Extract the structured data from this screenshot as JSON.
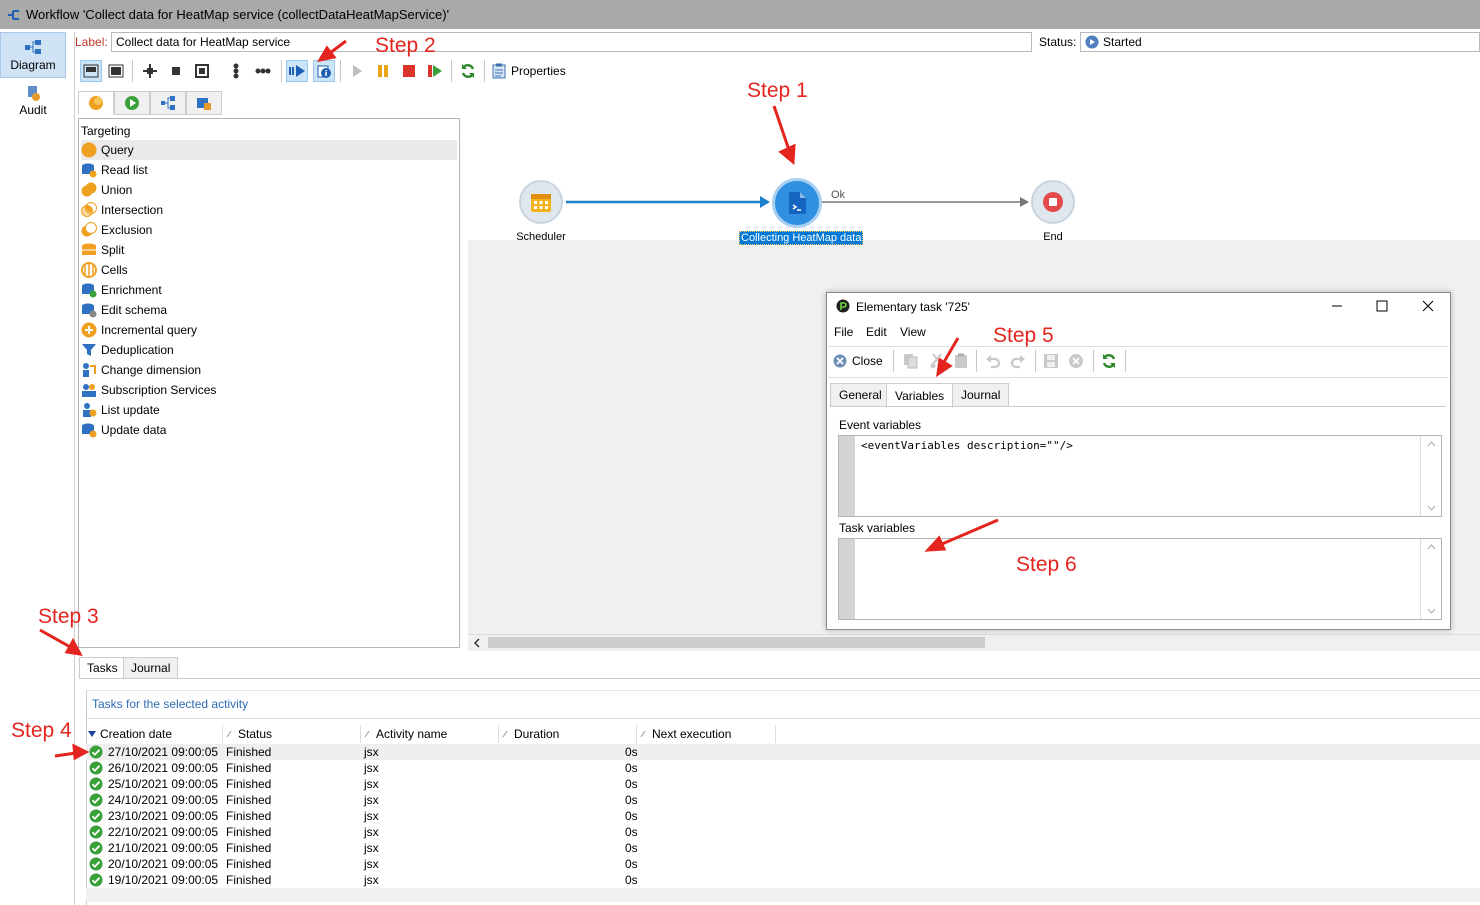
{
  "window": {
    "title": "Workflow 'Collect data for HeatMap service (collectDataHeatMapService)'"
  },
  "nav": [
    {
      "label": "Diagram",
      "icon": "diagram-icon"
    },
    {
      "label": "Audit",
      "icon": "audit-icon"
    }
  ],
  "header": {
    "label_caption": "Label:",
    "label_value": "Collect data for HeatMap service",
    "status_caption": "Status:",
    "status_value": "Started"
  },
  "toolbar": {
    "properties_label": "Properties"
  },
  "palette": {
    "section": "Targeting",
    "items": [
      "Query",
      "Read list",
      "Union",
      "Intersection",
      "Exclusion",
      "Split",
      "Cells",
      "Enrichment",
      "Edit schema",
      "Incremental query",
      "Deduplication",
      "Change dimension",
      "Subscription Services",
      "List update",
      "Update data"
    ]
  },
  "diagram": {
    "nodes": [
      "Scheduler",
      "Collecting HeatMap data",
      "End"
    ],
    "transition_label": "Ok"
  },
  "dialog": {
    "title": "Elementary task '725'",
    "menu": [
      "File",
      "Edit",
      "View"
    ],
    "close_label": "Close",
    "tabs": [
      "General",
      "Variables",
      "Journal"
    ],
    "event_variables_label": "Event variables",
    "event_variables_value": "<eventVariables description=\"\"/>",
    "task_variables_label": "Task variables",
    "task_variables_value": ""
  },
  "bottom": {
    "tabs": [
      "Tasks",
      "Journal"
    ],
    "caption": "Tasks for the selected activity",
    "columns": [
      "Creation date",
      "Status",
      "Activity name",
      "Duration",
      "Next execution"
    ],
    "rows": [
      {
        "date": "27/10/2021 09:00:05",
        "status": "Finished",
        "activity": "jsx",
        "duration": "0s",
        "next": ""
      },
      {
        "date": "26/10/2021 09:00:05",
        "status": "Finished",
        "activity": "jsx",
        "duration": "0s",
        "next": ""
      },
      {
        "date": "25/10/2021 09:00:05",
        "status": "Finished",
        "activity": "jsx",
        "duration": "0s",
        "next": ""
      },
      {
        "date": "24/10/2021 09:00:05",
        "status": "Finished",
        "activity": "jsx",
        "duration": "0s",
        "next": ""
      },
      {
        "date": "23/10/2021 09:00:05",
        "status": "Finished",
        "activity": "jsx",
        "duration": "0s",
        "next": ""
      },
      {
        "date": "22/10/2021 09:00:05",
        "status": "Finished",
        "activity": "jsx",
        "duration": "0s",
        "next": ""
      },
      {
        "date": "21/10/2021 09:00:05",
        "status": "Finished",
        "activity": "jsx",
        "duration": "0s",
        "next": ""
      },
      {
        "date": "20/10/2021 09:00:05",
        "status": "Finished",
        "activity": "jsx",
        "duration": "0s",
        "next": ""
      },
      {
        "date": "19/10/2021 09:00:05",
        "status": "Finished",
        "activity": "jsx",
        "duration": "0s",
        "next": ""
      }
    ]
  },
  "annotations": [
    "Step 1",
    "Step 2",
    "Step 3",
    "Step 4",
    "Step 5",
    "Step 6"
  ],
  "colors": {
    "annotation": "#e4251f",
    "selection": "#0078d7",
    "link": "#1e7fcb",
    "finished": "#3aa03a"
  }
}
